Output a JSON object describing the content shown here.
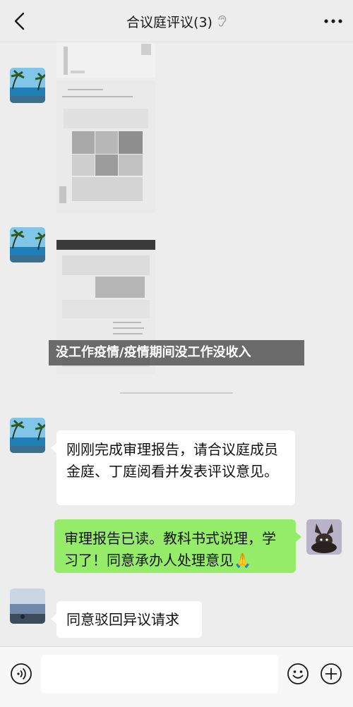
{
  "header": {
    "title": "合议庭评议(3)",
    "back_icon": "chevron-left-icon",
    "mute_icon": "ear-icon",
    "more_icon": "ellipsis-icon"
  },
  "overlay": {
    "caption": "没工作疫情/疫情期间没工作没收入"
  },
  "messages": [
    {
      "side": "left",
      "type": "image",
      "content": "blurred-document"
    },
    {
      "side": "left",
      "type": "image",
      "content": "blurred-document"
    },
    {
      "side": "left",
      "type": "text",
      "text": "刚刚完成审理报告，请合议庭成员金庭、丁庭阅看并发表评议意见。"
    },
    {
      "side": "right",
      "type": "text",
      "text": "审理报告已读。教科书式说理，学习了！同意承办人处理意见",
      "emoji": "🙏"
    },
    {
      "side": "left",
      "type": "text",
      "text": "同意驳回异议请求"
    }
  ],
  "input_bar": {
    "voice_icon": "voice-icon",
    "emoji_icon": "smile-icon",
    "plus_icon": "plus-circle-icon"
  },
  "colors": {
    "background": "#ededed",
    "sent_bubble": "#95ec69",
    "received_bubble": "#ffffff"
  }
}
